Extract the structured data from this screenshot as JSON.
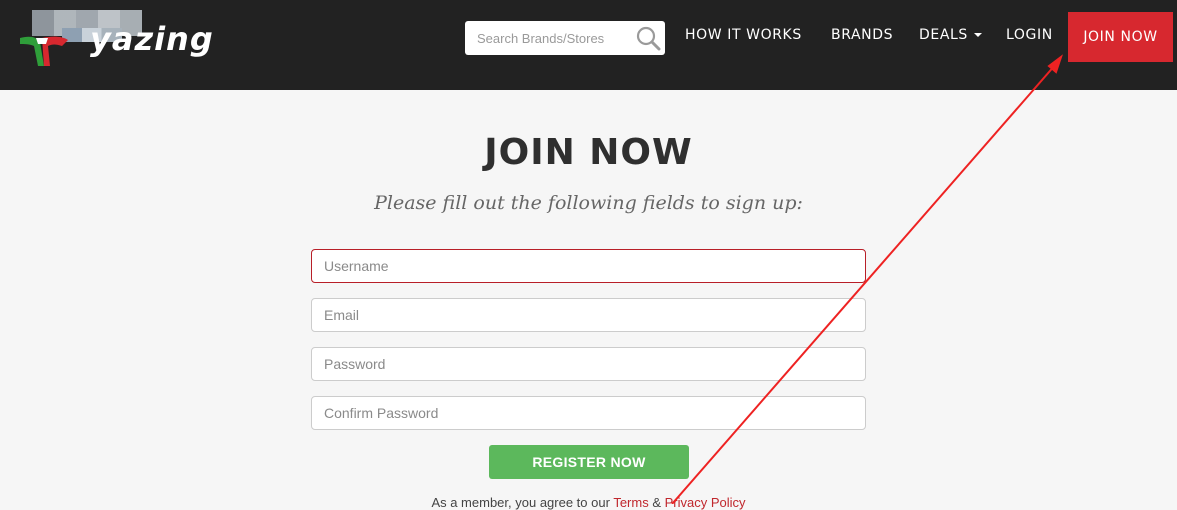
{
  "header": {
    "logo_text": "yazing",
    "search": {
      "placeholder": "Search Brands/Stores"
    },
    "nav": {
      "how_it_works": "HOW IT WORKS",
      "brands": "BRANDS",
      "deals": "DEALS",
      "login": "LOGIN",
      "join_now": "JOIN NOW"
    }
  },
  "main": {
    "title": "JOIN NOW",
    "subtitle": "Please fill out the following fields to sign up:",
    "form": {
      "username_placeholder": "Username",
      "email_placeholder": "Email",
      "password_placeholder": "Password",
      "confirm_password_placeholder": "Confirm Password",
      "register_label": "REGISTER NOW"
    },
    "agreement": {
      "prefix": "As a member, you agree to our",
      "terms": "Terms",
      "and": "&",
      "privacy": "Privacy Policy"
    }
  },
  "colors": {
    "header_bg": "#222222",
    "join_button": "#d7282f",
    "register_button": "#5cb85c",
    "annotation_arrow": "#ee2222"
  }
}
